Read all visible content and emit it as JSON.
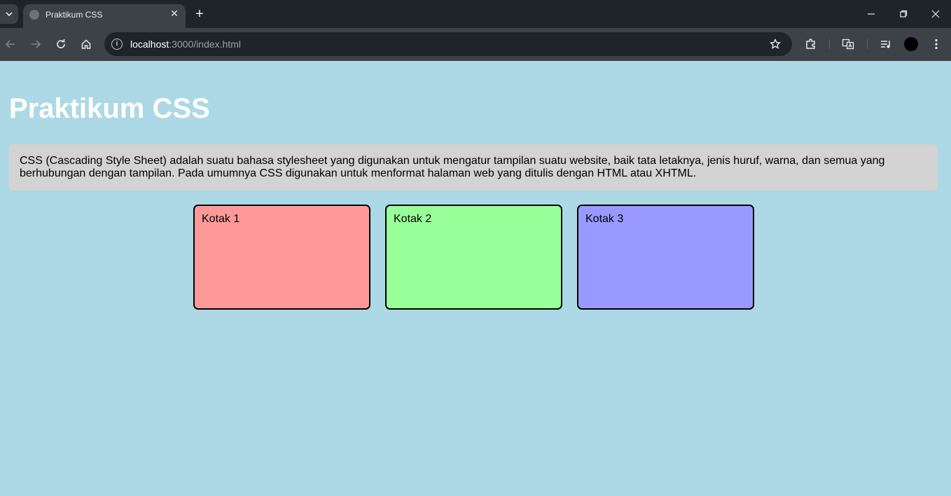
{
  "browser": {
    "tab_title": "Praktikum CSS",
    "url_host": "localhost",
    "url_path": ":3000/index.html"
  },
  "page": {
    "heading": "Praktikum CSS",
    "description": "CSS (Cascading Style Sheet) adalah suatu bahasa stylesheet yang digunakan untuk mengatur tampilan suatu website, baik tata letaknya, jenis huruf, warna, dan semua yang berhubungan dengan tampilan. Pada umumnya CSS digunakan untuk menformat halaman web yang ditulis dengan HTML atau XHTML.",
    "boxes": [
      {
        "label": "Kotak 1",
        "color": "#ff9999"
      },
      {
        "label": "Kotak 2",
        "color": "#99ff99"
      },
      {
        "label": "Kotak 3",
        "color": "#9999ff"
      }
    ]
  },
  "colors": {
    "page_background": "#add8e6",
    "description_background": "#d3d3d3"
  }
}
